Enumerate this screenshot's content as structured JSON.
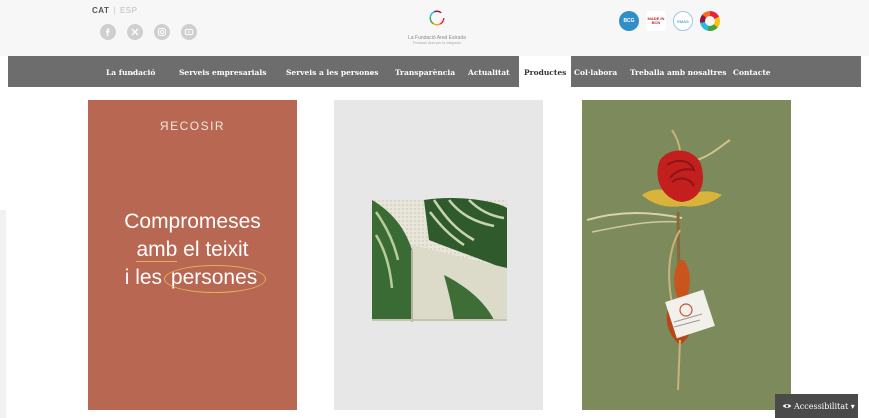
{
  "header": {
    "languages": {
      "current": "CAT",
      "other": "ESP"
    },
    "social_icons": [
      "facebook-icon",
      "twitter-icon",
      "instagram-icon",
      "youtube-icon"
    ],
    "logo": {
      "name": "La Fundació Ared Estrada",
      "tagline": "Fundació Ared per la integració"
    },
    "certifications": [
      {
        "icon": "b-corp-badge-icon",
        "text": "BCG"
      },
      {
        "icon": "empresa-badge-icon",
        "text": "MADE IN BCN"
      },
      {
        "icon": "sustainability-badge-icon",
        "text": "EMAS"
      },
      {
        "icon": "sdg-wheel-icon",
        "text": ""
      }
    ]
  },
  "nav": {
    "items": [
      {
        "label": "La fundació",
        "has_submenu": true
      },
      {
        "label": "Serveis empresarials",
        "has_submenu": true
      },
      {
        "label": "Serveis a les persones",
        "has_submenu": true
      },
      {
        "label": "Transparència",
        "has_submenu": false
      },
      {
        "label": "Actualitat",
        "has_submenu": false
      },
      {
        "label": "Productes",
        "has_submenu": false,
        "active": true
      },
      {
        "label": "Col·labora",
        "has_submenu": false
      },
      {
        "label": "Treballa amb nosaltres",
        "has_submenu": false
      },
      {
        "label": "Contacte",
        "has_submenu": false
      }
    ]
  },
  "cards": {
    "recosir": {
      "brand": "ЯECOSIR",
      "line1": "Compromeses",
      "line2a": "amb",
      "line2b": " el teixit",
      "line3a": "i les ",
      "line3b": "persones"
    },
    "bag_image": "fabric-pouch-image",
    "rose_image": "fabric-rose-image"
  },
  "accessibility": {
    "label": "Accessibilitat",
    "icon": "eye-icon"
  },
  "colors": {
    "nav_bg": "#6d6d6d",
    "recosir_bg": "#b86752",
    "accent_circle": "#e2b25a",
    "rose_bg": "#7d8a5c"
  }
}
